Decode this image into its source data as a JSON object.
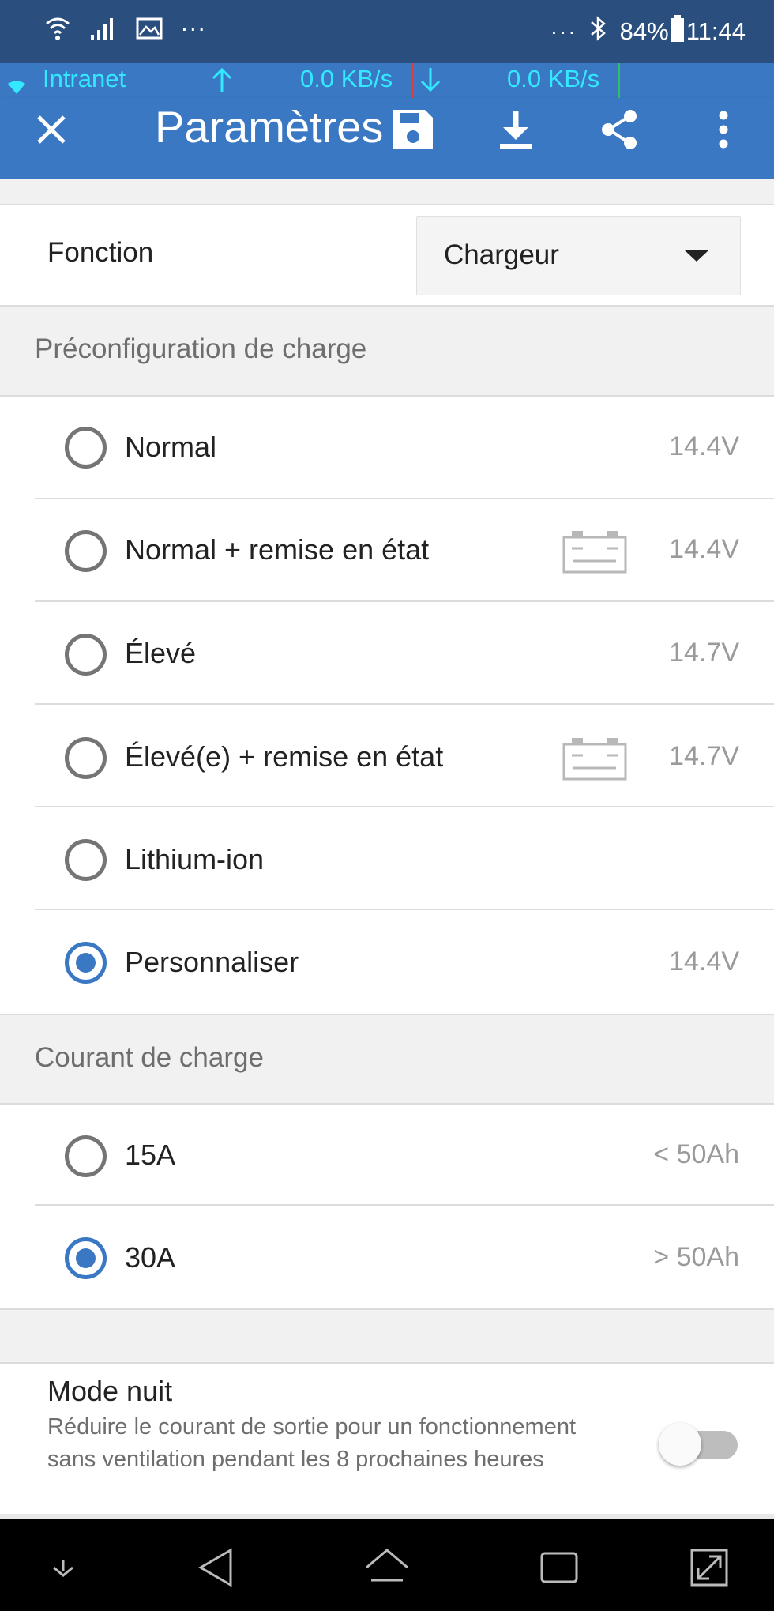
{
  "status_bar": {
    "battery": "84%",
    "time": "11:44",
    "left_more": "···",
    "right_more": "···"
  },
  "speed_overlay": {
    "network": "Intranet",
    "up_speed": "0.0 KB/s",
    "down_speed": "0.0 KB/s"
  },
  "app_bar": {
    "title": "Paramètres",
    "icons": [
      "close-icon",
      "save-icon",
      "download-icon",
      "share-icon",
      "more-vert-icon"
    ]
  },
  "function": {
    "label": "Fonction",
    "selected": "Chargeur"
  },
  "charge_preset": {
    "header": "Préconfiguration de charge",
    "options": [
      {
        "label": "Normal",
        "value": "14.4V",
        "selected": false,
        "battery_icon": false
      },
      {
        "label": "Normal + remise en état",
        "value": "14.4V",
        "selected": false,
        "battery_icon": true
      },
      {
        "label": "Élevé",
        "value": "14.7V",
        "selected": false,
        "battery_icon": false
      },
      {
        "label": "Élevé(e) + remise en état",
        "value": "14.7V",
        "selected": false,
        "battery_icon": true
      },
      {
        "label": "Lithium-ion",
        "value": "",
        "selected": false,
        "battery_icon": false
      },
      {
        "label": "Personnaliser",
        "value": "14.4V",
        "selected": true,
        "battery_icon": false
      }
    ]
  },
  "charge_current": {
    "header": "Courant de charge",
    "options": [
      {
        "label": "15A",
        "value": "< 50Ah",
        "selected": false
      },
      {
        "label": "30A",
        "value": "> 50Ah",
        "selected": true
      }
    ]
  },
  "night_mode": {
    "title": "Mode nuit",
    "description": "Réduire le courant de sortie pour un fonctionnement sans ventilation pendant les 8 prochaines heures",
    "enabled": false
  },
  "colors": {
    "status_bar": "#2a4e7e",
    "app_bar": "#3a78c4",
    "speed_text": "#33e8ff",
    "accent": "#3a78c4"
  }
}
